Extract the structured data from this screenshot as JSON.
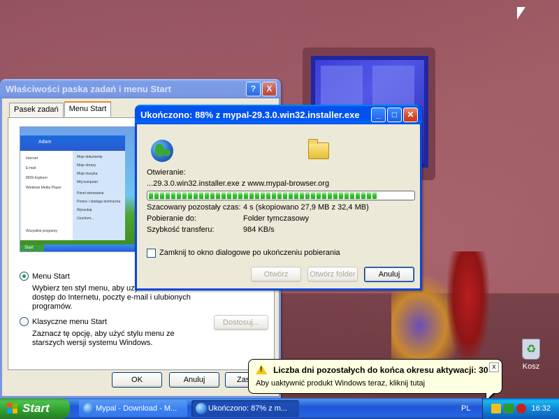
{
  "props_window": {
    "title": "Właściwości paska zadań i menu Start",
    "help_btn": "?",
    "close_btn": "X",
    "tabs": [
      "Pasek zadań",
      "Menu Start"
    ],
    "preview": {
      "user": "Adam",
      "left_items": [
        "Internet",
        "E-mail",
        "MSN Explorer",
        "Windows Media Player"
      ],
      "right_items": [
        "Moje dokumenty",
        "Moje obrazy",
        "Moja muzyka",
        "Mój komputer",
        "Panel sterowania",
        "Pomoc i obsługa techniczna",
        "Wyszukaj",
        "Uruchom..."
      ],
      "all_programs": "Wszystkie programy",
      "start": "Start"
    },
    "radio_start": "Menu Start",
    "radio_start_desc": "Wybierz ten styl menu, aby uzys",
    "radio_start_desc2": "dostęp do Internetu, poczty e-mail i ulubionych",
    "radio_start_desc3": "programów.",
    "radio_classic": "Klasyczne menu Start",
    "radio_classic_desc": "Zaznacz tę opcję, aby użyć stylu menu ze",
    "radio_classic_desc2": "starszych wersji systemu Windows.",
    "customize_btn": "Dostosuj...",
    "ok_btn": "OK",
    "cancel_btn": "Anuluj",
    "apply_btn_partial": "Zas"
  },
  "download": {
    "title": "Ukończono: 88% z mypal-29.3.0.win32.installer.exe",
    "opening_label": "Otwieranie:",
    "source": "...29.3.0.win32.installer.exe z www.mypal-browser.org",
    "progress_percent": 88,
    "rows": [
      {
        "label": "Szacowany pozostały czas:",
        "value": "4 s (skopiowano 27,9 MB z 32,4 MB)"
      },
      {
        "label": "Pobieranie do:",
        "value": "Folder tymczasowy"
      },
      {
        "label": "Szybkość transferu:",
        "value": "984 KB/s"
      }
    ],
    "checkbox_label": "Zamknij to okno dialogowe po ukończeniu pobierania",
    "open_btn": "Otwórz",
    "open_folder_btn": "Otwórz folder",
    "cancel_btn": "Anuluj"
  },
  "balloon": {
    "title": "Liczba dni pozostałych do końca okresu aktywacji: 30",
    "text": "Aby uaktywnić produkt Windows teraz, kliknij tutaj",
    "close": "x"
  },
  "desktop": {
    "recycle_bin": "Kosz"
  },
  "taskbar": {
    "start": "Start",
    "tasks": [
      "Mypal - Download - M...",
      "Ukończono: 87% z m..."
    ],
    "language": "PL",
    "clock": "16:32"
  },
  "colors": {
    "xp_blue": "#0053ee",
    "start_green": "#3c9b3c",
    "progress_green": "#37c331",
    "balloon_yellow": "#ffffe1"
  }
}
